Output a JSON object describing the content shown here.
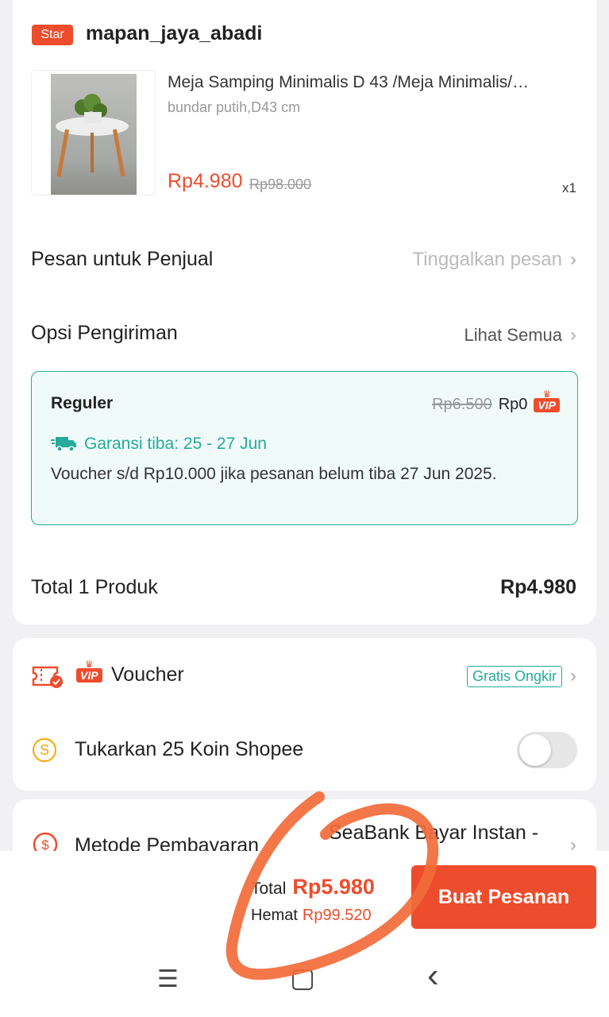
{
  "shop": {
    "badge": "Star",
    "name": "mapan_jaya_abadi"
  },
  "product": {
    "title": "Meja Samping Minimalis D 43 /Meja Minimalis/…",
    "variant": "bundar putih,D43 cm",
    "price": "Rp4.980",
    "original_price": "Rp98.000",
    "quantity": "x1"
  },
  "message": {
    "label": "Pesan untuk Penjual",
    "placeholder": "Tinggalkan pesan"
  },
  "shipping": {
    "label": "Opsi Pengiriman",
    "see_all": "Lihat Semua",
    "option": {
      "name": "Reguler",
      "original_price": "Rp6.500",
      "price": "Rp0",
      "badge": "VIP",
      "guarantee": "Garansi tiba: 25 - 27 Jun",
      "voucher_note": "Voucher s/d  Rp10.000 jika pesanan belum tiba 27 Jun 2025."
    }
  },
  "summary": {
    "label": "Total 1 Produk",
    "value": "Rp4.980"
  },
  "voucher": {
    "badge": "VIP",
    "label": "Voucher",
    "tag": "Gratis Ongkir"
  },
  "coins": {
    "label": "Tukarkan 25 Koin Shopee",
    "icon_letter": "S",
    "enabled": false
  },
  "payment": {
    "label": "Metode Pembayaran",
    "value": "SeaBank Bayar Instan -"
  },
  "checkout": {
    "total_label": "Total",
    "total_value": "Rp5.980",
    "saving_label": "Hemat",
    "saving_value": "Rp99.520",
    "button": "Buat Pesanan"
  },
  "nav": {
    "menu": "☰",
    "home": "▢",
    "back": "‹"
  },
  "colors": {
    "brand": "#ee4d2d",
    "teal": "#26aa99",
    "annotation": "#f26b3a"
  }
}
